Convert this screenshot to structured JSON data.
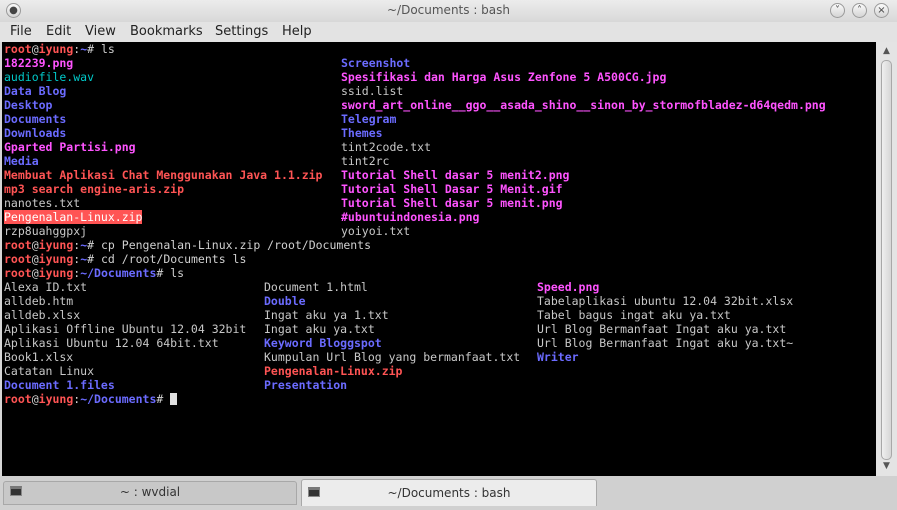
{
  "window": {
    "title": "~/Documents : bash"
  },
  "menu": [
    "File",
    "Edit",
    "View",
    "Bookmarks",
    "Settings",
    "Help"
  ],
  "terminal": {
    "lines": [
      {
        "type": "prompt",
        "user": "root",
        "at": "@",
        "host": "iyung",
        "colon": ":",
        "path": "~",
        "sym": "#",
        "cmd": " ls"
      },
      {
        "type": "ls",
        "cells": [
          {
            "text": "182239.png",
            "cls": "img"
          },
          {
            "text": "Screenshot",
            "cls": "dir"
          }
        ]
      },
      {
        "type": "ls",
        "cells": [
          {
            "text": "audiofile.wav",
            "cls": "aud"
          },
          {
            "text": "Spesifikasi dan Harga Asus Zenfone 5 A500CG.jpg",
            "cls": "img"
          }
        ]
      },
      {
        "type": "ls",
        "cells": [
          {
            "text": "Data Blog",
            "cls": "dir"
          },
          {
            "text": "ssid.list",
            "cls": "file"
          }
        ]
      },
      {
        "type": "ls",
        "cells": [
          {
            "text": "Desktop",
            "cls": "dir"
          },
          {
            "text": "sword_art_online__ggo__asada_shino__sinon_by_stormofbladez-d64qedm.png",
            "cls": "img"
          }
        ]
      },
      {
        "type": "ls",
        "cells": [
          {
            "text": "Documents",
            "cls": "dir"
          },
          {
            "text": "Telegram",
            "cls": "dir"
          }
        ]
      },
      {
        "type": "ls",
        "cells": [
          {
            "text": "Downloads",
            "cls": "dir"
          },
          {
            "text": "Themes",
            "cls": "dir"
          }
        ]
      },
      {
        "type": "ls",
        "cells": [
          {
            "text": "Gparted Partisi.png",
            "cls": "img"
          },
          {
            "text": "tint2code.txt",
            "cls": "file"
          }
        ]
      },
      {
        "type": "ls",
        "cells": [
          {
            "text": "Media",
            "cls": "dir"
          },
          {
            "text": "tint2rc",
            "cls": "file"
          }
        ]
      },
      {
        "type": "ls",
        "cells": [
          {
            "text": "Membuat Aplikasi Chat Menggunakan Java 1.1.zip",
            "cls": "zip"
          },
          {
            "text": "Tutorial Shell dasar 5 menit2.png",
            "cls": "img"
          }
        ]
      },
      {
        "type": "ls",
        "cells": [
          {
            "text": "mp3 search engine-aris.zip",
            "cls": "zip"
          },
          {
            "text": "Tutorial Shell Dasar 5 Menit.gif",
            "cls": "img"
          }
        ]
      },
      {
        "type": "ls",
        "cells": [
          {
            "text": "nanotes.txt",
            "cls": "file"
          },
          {
            "text": "Tutorial Shell dasar 5 menit.png",
            "cls": "img"
          }
        ]
      },
      {
        "type": "ls",
        "cells": [
          {
            "text": "Pengenalan-Linux.zip",
            "cls": "zip hl"
          },
          {
            "text": "#ubuntuindonesia.png",
            "cls": "img"
          }
        ]
      },
      {
        "type": "ls",
        "cells": [
          {
            "text": "rzp8uahggpxj",
            "cls": "file"
          },
          {
            "text": "yoiyoi.txt",
            "cls": "file"
          }
        ]
      },
      {
        "type": "prompt",
        "user": "root",
        "at": "@",
        "host": "iyung",
        "colon": ":",
        "path": "~",
        "sym": "#",
        "cmd": " cp Pengenalan-Linux.zip /root/Documents"
      },
      {
        "type": "prompt",
        "user": "root",
        "at": "@",
        "host": "iyung",
        "colon": ":",
        "path": "~",
        "sym": "#",
        "cmd": " cd /root/Documents ls"
      },
      {
        "type": "prompt",
        "user": "root",
        "at": "@",
        "host": "iyung",
        "colon": ":",
        "path": "~/Documents",
        "sym": "#",
        "cmd": " ls"
      },
      {
        "type": "ls3",
        "cells": [
          {
            "text": "Alexa ID.txt",
            "cls": "file"
          },
          {
            "text": "Document 1.html",
            "cls": "file"
          },
          {
            "text": "Speed.png",
            "cls": "img"
          }
        ]
      },
      {
        "type": "ls3",
        "cells": [
          {
            "text": "alldeb.htm",
            "cls": "file"
          },
          {
            "text": "Double",
            "cls": "dir"
          },
          {
            "text": "Tabelaplikasi ubuntu 12.04 32bit.xlsx",
            "cls": "file"
          }
        ]
      },
      {
        "type": "ls3",
        "cells": [
          {
            "text": "alldeb.xlsx",
            "cls": "file"
          },
          {
            "text": "Ingat aku ya 1.txt",
            "cls": "file"
          },
          {
            "text": "Tabel bagus ingat aku ya.txt",
            "cls": "file"
          }
        ]
      },
      {
        "type": "ls3",
        "cells": [
          {
            "text": "Aplikasi Offline Ubuntu 12.04 32bit",
            "cls": "file"
          },
          {
            "text": "Ingat aku ya.txt",
            "cls": "file"
          },
          {
            "text": "Url Blog Bermanfaat Ingat aku ya.txt",
            "cls": "file"
          }
        ]
      },
      {
        "type": "ls3",
        "cells": [
          {
            "text": "Aplikasi Ubuntu 12.04 64bit.txt",
            "cls": "file"
          },
          {
            "text": "Keyword Bloggspot",
            "cls": "dir"
          },
          {
            "text": "Url Blog Bermanfaat Ingat aku ya.txt~",
            "cls": "file"
          }
        ]
      },
      {
        "type": "ls3",
        "cells": [
          {
            "text": "Book1.xlsx",
            "cls": "file"
          },
          {
            "text": "Kumpulan Url Blog yang bermanfaat.txt",
            "cls": "file"
          },
          {
            "text": "Writer",
            "cls": "dir"
          }
        ]
      },
      {
        "type": "ls3",
        "cells": [
          {
            "text": "Catatan Linux",
            "cls": "file"
          },
          {
            "text": "Pengenalan-Linux.zip",
            "cls": "zip"
          },
          {
            "text": "",
            "cls": "file"
          }
        ]
      },
      {
        "type": "ls3",
        "cells": [
          {
            "text": "Document 1.files",
            "cls": "dir"
          },
          {
            "text": "Presentation",
            "cls": "dir"
          },
          {
            "text": "",
            "cls": "file"
          }
        ]
      },
      {
        "type": "prompt",
        "user": "root",
        "at": "@",
        "host": "iyung",
        "colon": ":",
        "path": "~/Documents",
        "sym": "#",
        "cmd": " ",
        "cursor": true
      }
    ]
  },
  "tabs": [
    {
      "label": "~ : wvdial",
      "active": false
    },
    {
      "label": "~/Documents : bash",
      "active": true
    }
  ],
  "colors": {
    "prompt_user": "#ff5454",
    "prompt_path": "#6b6bff",
    "directory": "#6b6bff",
    "image": "#ff54ff",
    "archive": "#ff5454",
    "audio": "#00c8c8",
    "text": "#c8c8c8"
  }
}
